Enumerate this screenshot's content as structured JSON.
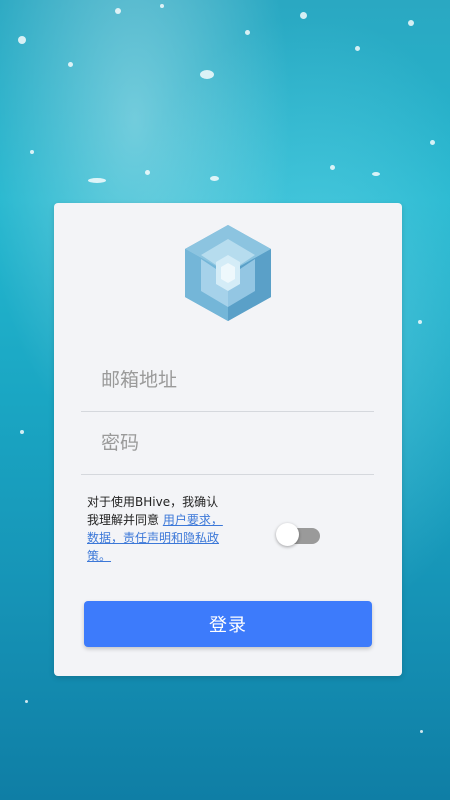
{
  "login": {
    "email_placeholder": "邮箱地址",
    "password_placeholder": "密码",
    "agreement_text": "对于使用BHive，我确认我理解并同意 ",
    "agreement_link": "用户要求，数据，责任声明和隐私政策。",
    "agreement_toggle_on": false,
    "login_label": "登录"
  },
  "icons": {
    "logo": "hexagon-cube-logo-icon"
  },
  "colors": {
    "accent": "#3d7bfb",
    "link": "#3c78d8",
    "card_bg": "#f3f4f7"
  }
}
